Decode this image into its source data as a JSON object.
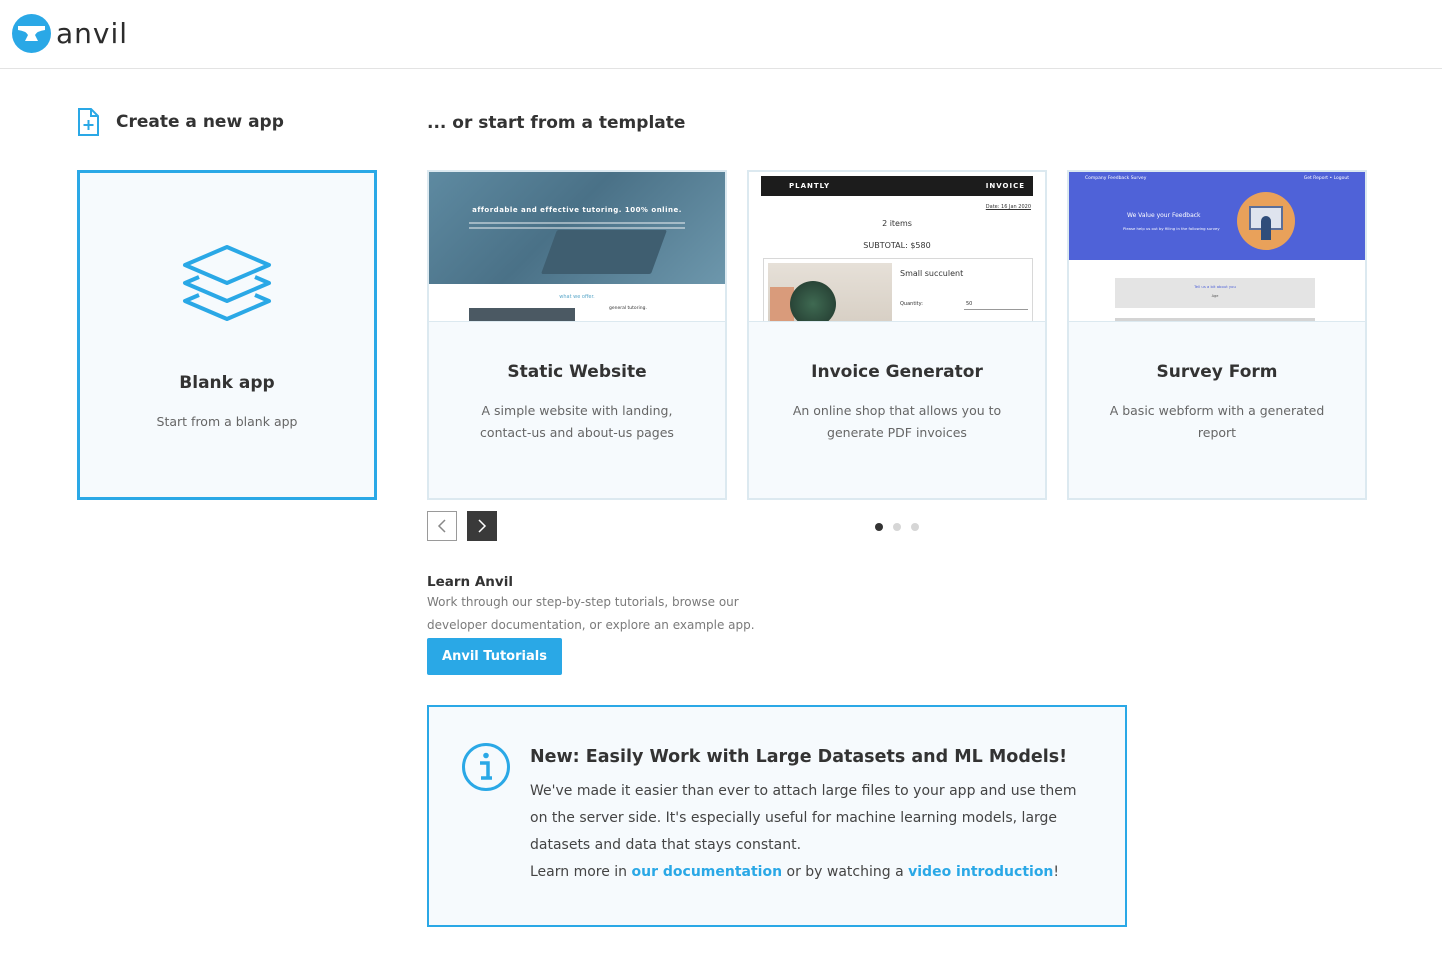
{
  "header": {
    "logo_text": "anvil",
    "brand_color": "#2aa8e6"
  },
  "create": {
    "heading": "Create a new app",
    "blank_title": "Blank app",
    "blank_subtitle": "Start from a blank app"
  },
  "templates": {
    "heading": "... or start from a template",
    "cards": [
      {
        "title": "Static Website",
        "description": "A simple website with landing, contact-us and about-us pages",
        "thumb": {
          "hero_title": "affordable and effective tutoring. 100% online.",
          "offer": "what we offer.",
          "general": "general tutoring."
        }
      },
      {
        "title": "Invoice Generator",
        "description": "An online shop that allows you to generate PDF invoices",
        "thumb": {
          "brand": "PLANTLY",
          "invoice": "INVOICE",
          "date": "Date: 16 Jan 2020",
          "items": "2 items",
          "subtotal": "SUBTOTAL: $580",
          "product": "Small succulent",
          "qty_label": "Quantity:",
          "qty_value": "50"
        }
      },
      {
        "title": "Survey Form",
        "description": "A basic webform with a generated report",
        "thumb": {
          "topbar": "Company Feedback Survey",
          "topbar_right": "Get Report   •  Logout",
          "hero": "We Value your Feedback",
          "hero_sub": "Please help us out by filling in the following survey",
          "form_title": "Tell us a bit about you",
          "form_field": "Age"
        }
      }
    ],
    "pagination": {
      "pages": 3,
      "active": 0
    }
  },
  "learn": {
    "title": "Learn Anvil",
    "description": "Work through our step-by-step tutorials, browse our developer documentation, or explore an example app.",
    "button_label": "Anvil Tutorials"
  },
  "notice": {
    "title": "New: Easily Work with Large Datasets and ML Models!",
    "body": "We've made it easier than ever to attach large files to your app and use them on the server side. It's especially useful for machine learning models, large datasets and data that stays constant.",
    "more_prefix": "Learn more in ",
    "doc_link": "our documentation",
    "more_middle": " or by watching a ",
    "video_link": "video introduction",
    "more_suffix": "!"
  }
}
